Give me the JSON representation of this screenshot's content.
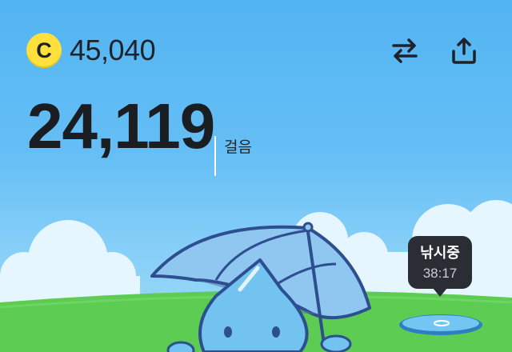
{
  "header": {
    "coin_letter": "C",
    "coin_balance": "45,040",
    "swap_icon": "swap-arrows-icon",
    "share_icon": "share-upload-icon"
  },
  "steps": {
    "count": "24,119",
    "unit": "걸음"
  },
  "status_bubble": {
    "label": "낚시중",
    "timer": "38:17"
  },
  "colors": {
    "sky": "#5ab9f3",
    "grass": "#5ccc52",
    "coin": "#ffe03d",
    "bubble": "#2a2d33"
  }
}
